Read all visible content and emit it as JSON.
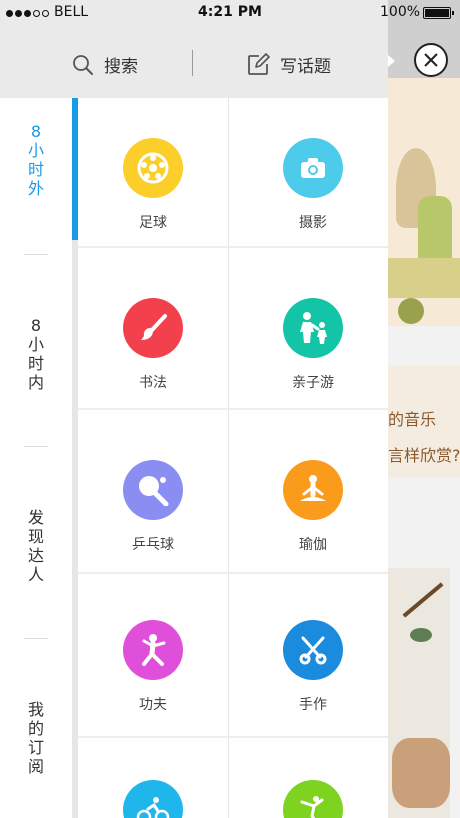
{
  "status_bar": {
    "carrier": "BELL",
    "time": "4:21 PM",
    "battery": "100%"
  },
  "top_bar": {
    "search_label": "搜索",
    "write_label": "写话题"
  },
  "nav": {
    "items": [
      {
        "label": "8小时外",
        "active": true
      },
      {
        "label": "8小时内",
        "active": false
      },
      {
        "label": "发现达人",
        "active": false
      },
      {
        "label": "我的订阅",
        "active": false
      }
    ]
  },
  "grid": {
    "items": [
      {
        "label": "足球",
        "icon": "soccer-ball-icon",
        "color": "#fbce2a"
      },
      {
        "label": "摄影",
        "icon": "camera-icon",
        "color": "#4dcbea"
      },
      {
        "label": "书法",
        "icon": "brush-icon",
        "color": "#f2414d"
      },
      {
        "label": "亲子游",
        "icon": "parent-child-icon",
        "color": "#14c4a6"
      },
      {
        "label": "乒乓球",
        "icon": "ping-pong-icon",
        "color": "#8a8ef3"
      },
      {
        "label": "瑜伽",
        "icon": "yoga-icon",
        "color": "#fb9b1b"
      },
      {
        "label": "功夫",
        "icon": "kungfu-icon",
        "color": "#e04fd9"
      },
      {
        "label": "手作",
        "icon": "scissors-icon",
        "color": "#1b8bde"
      },
      {
        "label": "",
        "icon": "cycling-icon",
        "color": "#1fb6ec"
      },
      {
        "label": "",
        "icon": "dance-icon",
        "color": "#7ed321"
      }
    ]
  },
  "background_content": {
    "text_line_1": "的音乐",
    "text_line_2": "言样欣赏?"
  }
}
